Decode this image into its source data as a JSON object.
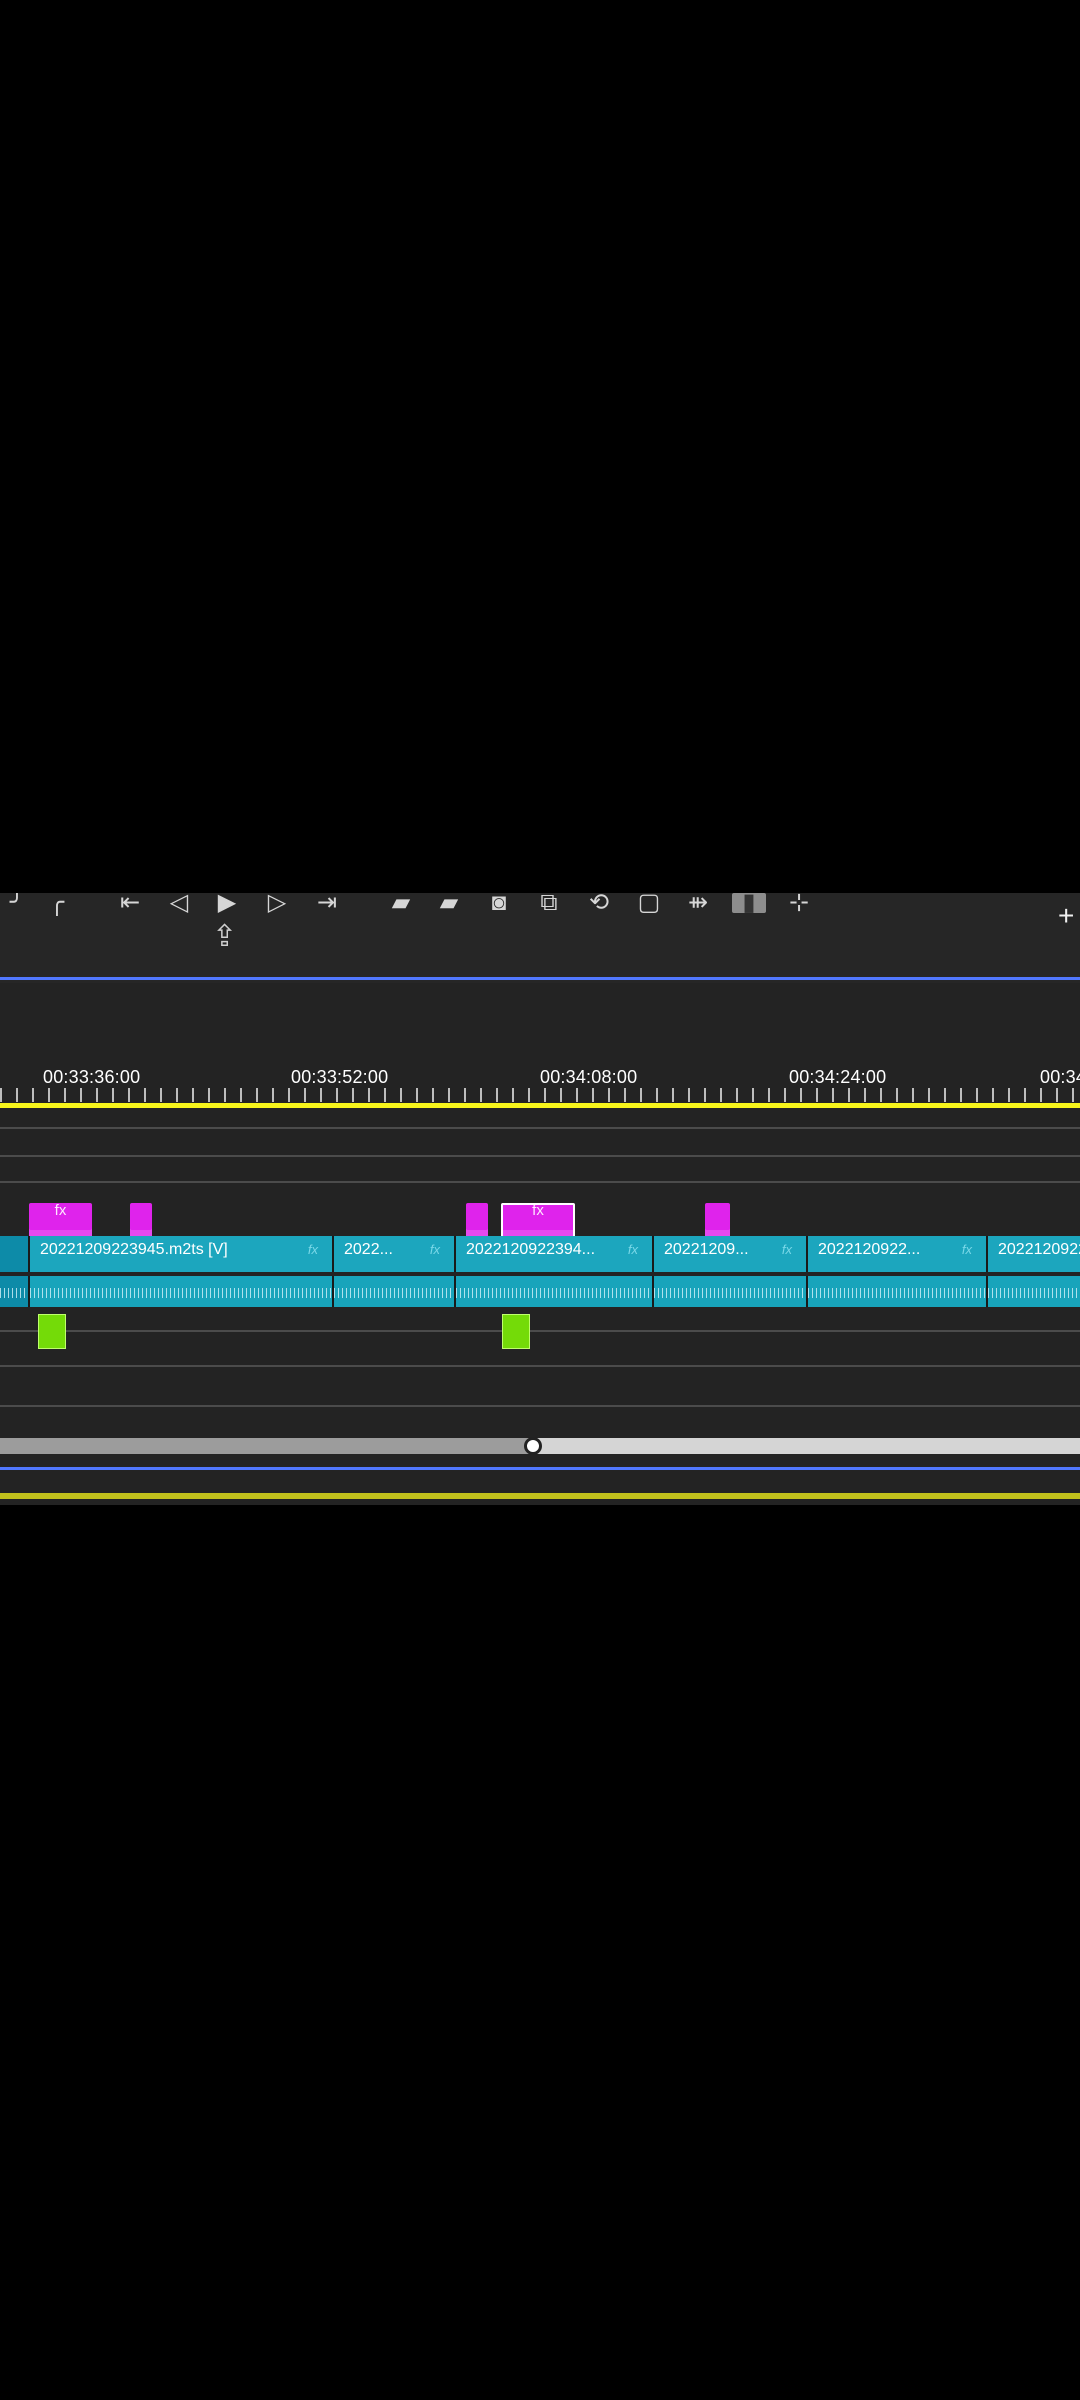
{
  "toolbar": {
    "icons": [
      {
        "name": "toolbar-track-icon",
        "symbol": "╯"
      },
      {
        "name": "toolbar-marker-icon",
        "symbol": "╭"
      },
      {
        "name": "toolbar-step-back-icon",
        "symbol": "⇤"
      },
      {
        "name": "toolbar-rewind-icon",
        "symbol": "◁"
      },
      {
        "name": "toolbar-play-icon",
        "symbol": "▶"
      },
      {
        "name": "toolbar-forward-icon",
        "symbol": "▷"
      },
      {
        "name": "toolbar-jump-icon",
        "symbol": "⇥"
      },
      {
        "name": "toolbar-lift-icon",
        "symbol": "▰"
      },
      {
        "name": "toolbar-extract-icon",
        "symbol": "▰"
      },
      {
        "name": "toolbar-camera-icon",
        "symbol": "◙"
      },
      {
        "name": "toolbar-insert-icon",
        "symbol": "⧉"
      },
      {
        "name": "toolbar-overwrite-icon",
        "symbol": "⟲"
      },
      {
        "name": "toolbar-safe-margin-icon",
        "symbol": "▢"
      },
      {
        "name": "toolbar-comparison-icon",
        "symbol": "⇻"
      },
      {
        "name": "toolbar-selected-icon",
        "symbol": "▮"
      },
      {
        "name": "toolbar-add-button-icon",
        "symbol": "⊹"
      }
    ],
    "export_symbol": "⇪",
    "plus_symbol": "+"
  },
  "timeline": {
    "timecodes": [
      "00:33:36:00",
      "00:33:52:00",
      "00:34:08:00",
      "00:34:24:00",
      "00:34"
    ],
    "fx_label": "fx",
    "video_clips": [
      {
        "name": "20221209223945.m2ts [V]",
        "fx": "fx"
      },
      {
        "name": "2022...",
        "fx": "fx"
      },
      {
        "name": "2022120922394...",
        "fx": "fx"
      },
      {
        "name": "20221209...",
        "fx": "fx"
      },
      {
        "name": "2022120922...",
        "fx": "fx"
      },
      {
        "name": "2022120922",
        "fx": ""
      }
    ]
  },
  "colors": {
    "timeline_bg": "#232323",
    "clip": "#1ca6be",
    "fx_clip": "#df23ec",
    "keyframe": "#74db08",
    "playhead": "#f7f51b",
    "selection_line": "#5178ff"
  }
}
